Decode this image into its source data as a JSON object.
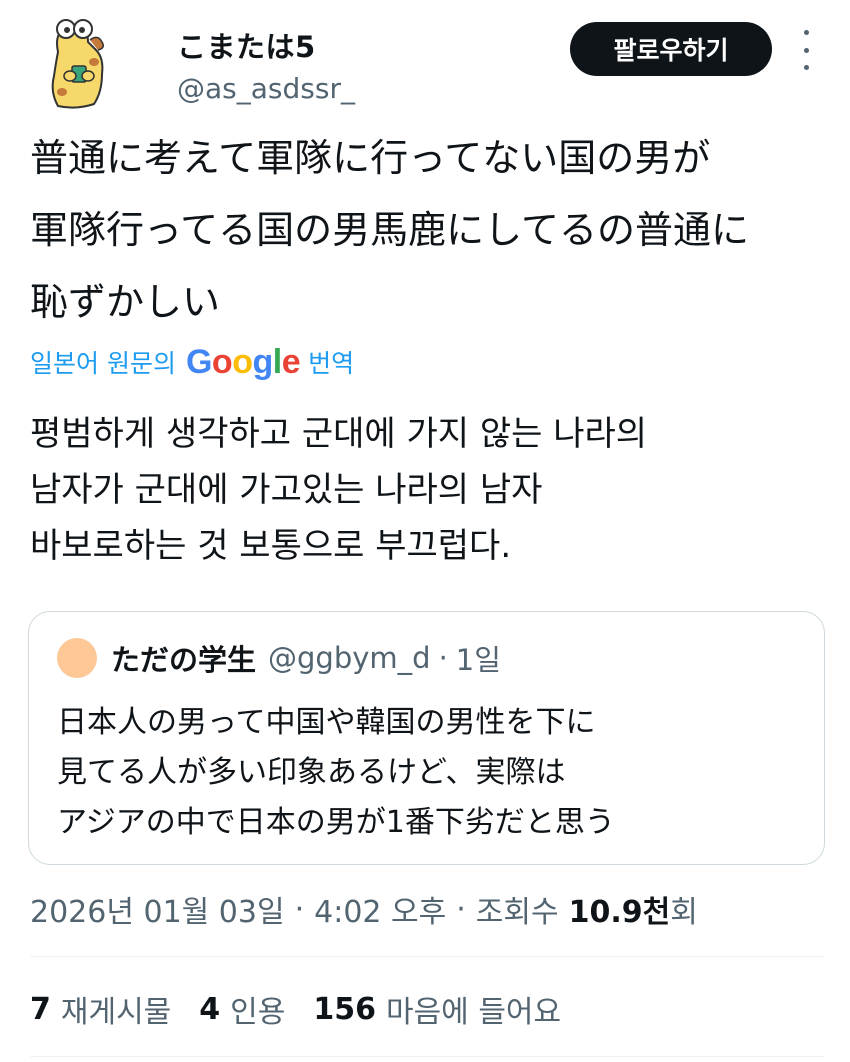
{
  "author": {
    "name": "こまたは5",
    "handle": "@as_asdssr_"
  },
  "follow_button": {
    "label": "팔로우하기"
  },
  "tweet": {
    "lines": [
      "普通に考えて軍隊に行ってない国の男が",
      "軍隊行ってる国の男馬鹿にしてるの普通に",
      "恥ずかしい"
    ]
  },
  "translation": {
    "prefix": "일본어 원문의",
    "google": [
      "G",
      "o",
      "o",
      "g",
      "l",
      "e"
    ],
    "suffix": "번역",
    "lines": [
      "평범하게 생각하고 군대에 가지 않는 나라의",
      "남자가 군대에 가고있는 나라의 남자",
      "바보로하는 것 보통으로 부끄럽다."
    ]
  },
  "quote": {
    "name": "ただの学生",
    "handle": "@ggbym_d",
    "separator": "·",
    "time": "1일",
    "lines": [
      "日本人の男って中国や韓国の男性を下に",
      "見てる人が多い印象あるけど、実際は",
      "アジアの中で日本の男が1番下劣だと思う"
    ]
  },
  "timestamp": {
    "date": "2026년 01월 03일",
    "separator": "·",
    "time": "4:02 오후",
    "views_label": "조회수",
    "views_number": "10.9천",
    "views_suffix": "회"
  },
  "stats": [
    {
      "count": "7",
      "label": "재게시물"
    },
    {
      "count": "4",
      "label": "인용"
    },
    {
      "count": "156",
      "label": "마음에 들어요"
    }
  ],
  "colors": {
    "text_primary": "#0f1419",
    "text_secondary": "#536471",
    "link": "#1d9bf0",
    "border": "#cfd9de",
    "button_bg": "#0f1419",
    "quote_avatar": "#fdc896"
  },
  "icons": {
    "avatar": "cartoon-avatar",
    "more": "more-vertical-icon"
  }
}
